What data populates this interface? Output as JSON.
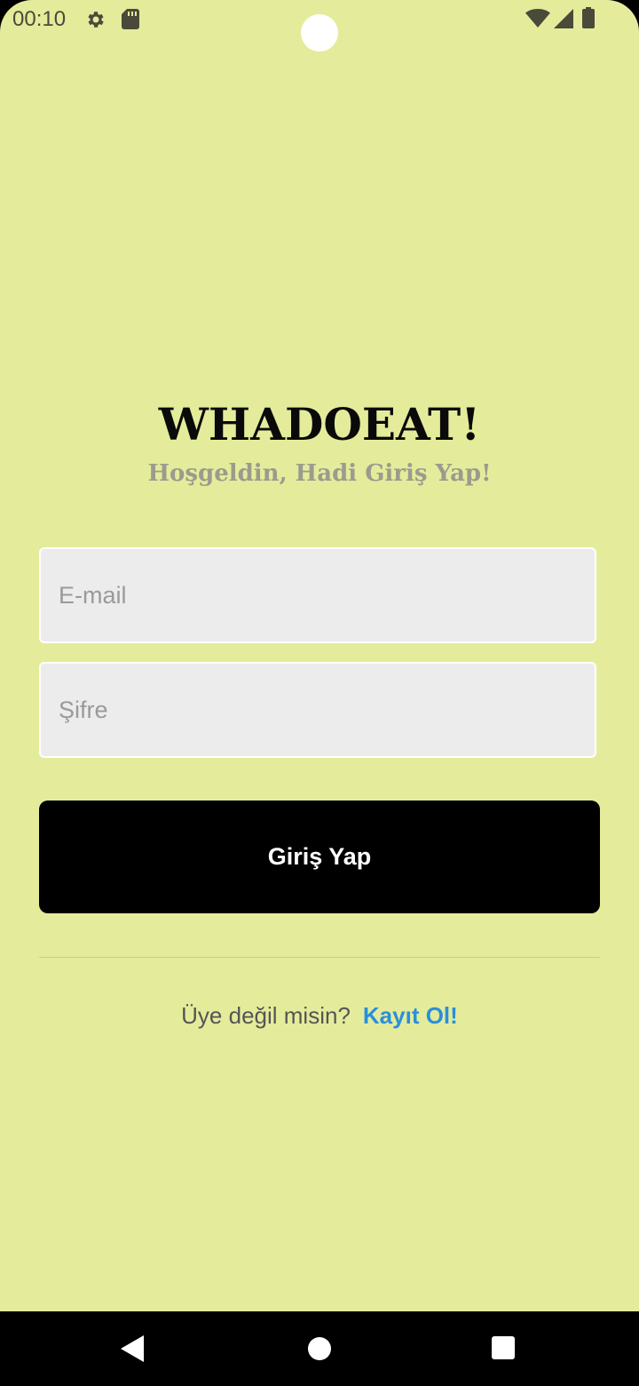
{
  "status_bar": {
    "time": "00:10",
    "icons": [
      "gear-icon",
      "sd-card-icon",
      "wifi-icon",
      "cell-signal-icon",
      "battery-icon"
    ]
  },
  "login": {
    "title": "WHADOEAT!",
    "subtitle": "Hoşgeldin, Hadi Giriş Yap!",
    "email_placeholder": "E-mail",
    "password_placeholder": "Şifre",
    "login_button_label": "Giriş Yap",
    "signup_question": "Üye değil misin?",
    "signup_link_label": "Kayıt Ol!"
  },
  "nav_bar": {
    "icons": [
      "back-icon",
      "home-icon",
      "recents-icon"
    ]
  },
  "colors": {
    "background": "#e4ec9b",
    "button": "#000000",
    "link": "#2a8fdc",
    "input_fill": "#ececec"
  }
}
